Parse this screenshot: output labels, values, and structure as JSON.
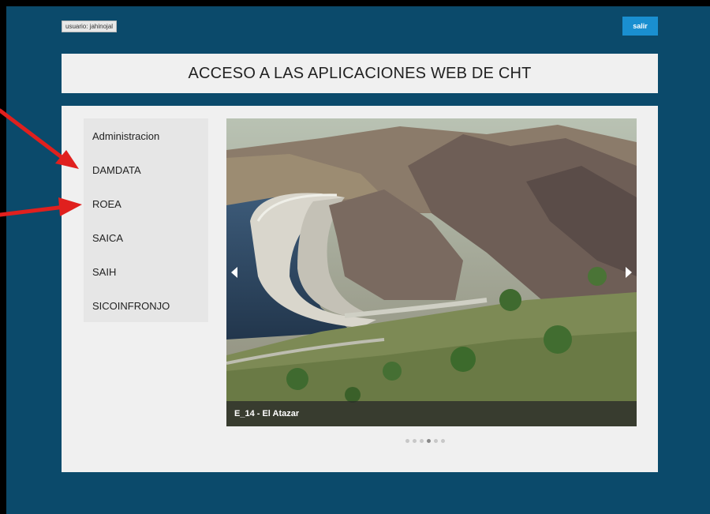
{
  "header": {
    "user_label": "usuario: jahinojal",
    "logout_label": "salir"
  },
  "title": "ACCESO A LAS APLICACIONES WEB DE CHT",
  "menu": {
    "items": [
      {
        "label": "Administracion"
      },
      {
        "label": "DAMDATA"
      },
      {
        "label": "ROEA"
      },
      {
        "label": "SAICA"
      },
      {
        "label": "SAIH"
      },
      {
        "label": "SICOINFRONJO"
      }
    ]
  },
  "slider": {
    "caption": "E_14 - El Atazar",
    "image_subject": "dam-landscape-photo",
    "slide_count": 6,
    "active_index": 3,
    "prev_icon": "triangle-left-icon",
    "next_icon": "triangle-right-icon"
  },
  "annotations": {
    "arrow_color": "#e0201e"
  },
  "colors": {
    "background": "#0b4a6b",
    "panel": "#f0f0f0",
    "logout_button": "#1a8fd0"
  }
}
